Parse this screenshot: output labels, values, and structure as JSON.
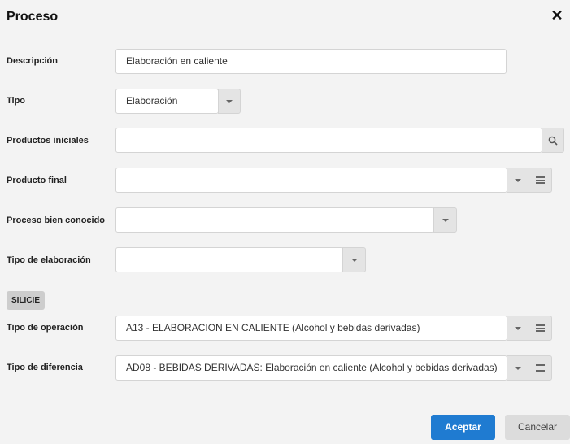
{
  "dialog": {
    "title": "Proceso",
    "close_icon": "close-icon"
  },
  "form": {
    "descripcion": {
      "label": "Descripción",
      "value": "Elaboración en caliente"
    },
    "tipo": {
      "label": "Tipo",
      "value": "Elaboración"
    },
    "productos_iniciales": {
      "label": "Productos iniciales",
      "value": ""
    },
    "producto_final": {
      "label": "Producto final",
      "value": ""
    },
    "proceso_bien_conocido": {
      "label": "Proceso bien conocido",
      "value": ""
    },
    "tipo_elaboracion": {
      "label": "Tipo de elaboración",
      "value": ""
    }
  },
  "silicie": {
    "section_label": "SILICIE",
    "tipo_operacion": {
      "label": "Tipo de operación",
      "value": "A13 - ELABORACION EN CALIENTE (Alcohol y bebidas derivadas)"
    },
    "tipo_diferencia": {
      "label": "Tipo de diferencia",
      "value": "AD08 - BEBIDAS DERIVADAS: Elaboración en caliente (Alcohol y bebidas derivadas)"
    }
  },
  "buttons": {
    "accept": "Aceptar",
    "cancel": "Cancelar"
  }
}
